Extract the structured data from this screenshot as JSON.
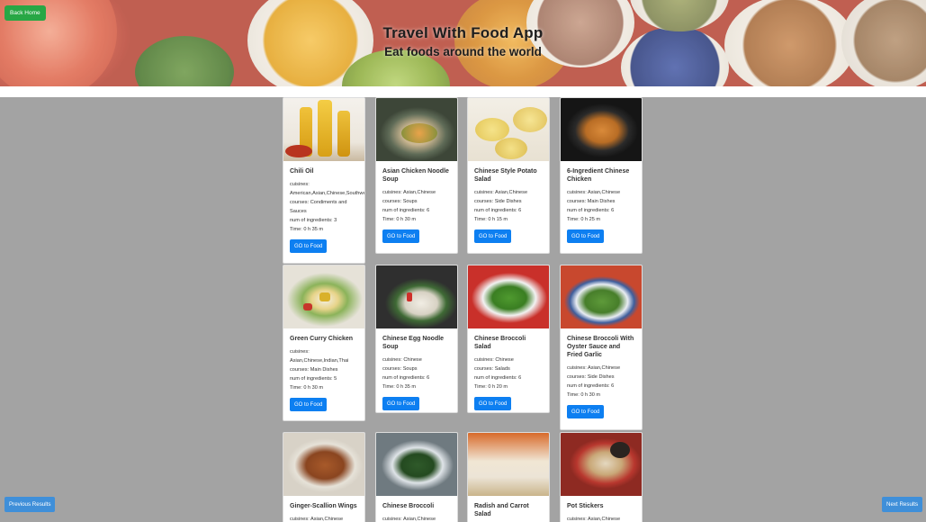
{
  "header": {
    "title": "Travel With Food App",
    "subtitle": "Eat foods around the world",
    "back_home_label": "Back Home"
  },
  "nav": {
    "previous_label": "Previous Results",
    "next_label": "Next Results"
  },
  "recipes": [
    {
      "title": "Chili Oil",
      "cuisines": "cuisines: American,Asian,Chinese,Southwestern",
      "courses": "courses: Condiments and Sauces",
      "ingredients": "num of ingredients: 3",
      "time": "Time: 0 h 35 m",
      "button": "GO to Food"
    },
    {
      "title": "Asian Chicken Noodle Soup",
      "cuisines": "cuisines: Asian,Chinese",
      "courses": "courses: Soups",
      "ingredients": "num of ingredients: 6",
      "time": "Time: 0 h 30 m",
      "button": "GO to Food"
    },
    {
      "title": "Chinese Style Potato Salad",
      "cuisines": "cuisines: Asian,Chinese",
      "courses": "courses: Side Dishes",
      "ingredients": "num of ingredients: 6",
      "time": "Time: 0 h 15 m",
      "button": "GO to Food"
    },
    {
      "title": "6-Ingredient Chinese Chicken",
      "cuisines": "cuisines: Asian,Chinese",
      "courses": "courses: Main Dishes",
      "ingredients": "num of ingredients: 6",
      "time": "Time: 0 h 25 m",
      "button": "GO to Food"
    },
    {
      "title": "Green Curry Chicken",
      "cuisines": "cuisines: Asian,Chinese,Indian,Thai",
      "courses": "courses: Main Dishes",
      "ingredients": "num of ingredients: 5",
      "time": "Time: 0 h 30 m",
      "button": "GO to Food"
    },
    {
      "title": "Chinese Egg Noodle Soup",
      "cuisines": "cuisines: Chinese",
      "courses": "courses: Soups",
      "ingredients": "num of ingredients: 6",
      "time": "Time: 0 h 35 m",
      "button": "GO to Food"
    },
    {
      "title": "Chinese Broccoli Salad",
      "cuisines": "cuisines: Chinese",
      "courses": "courses: Salads",
      "ingredients": "num of ingredients: 6",
      "time": "Time: 0 h 20 m",
      "button": "GO to Food"
    },
    {
      "title": "Chinese Broccoli With Oyster Sauce and Fried Garlic",
      "cuisines": "cuisines: Asian,Chinese",
      "courses": "courses: Side Dishes",
      "ingredients": "num of ingredients: 6",
      "time": "Time: 0 h 30 m",
      "button": "GO to Food"
    },
    {
      "title": "Ginger-Scallion Wings",
      "cuisines": "cuisines: Asian,Chinese",
      "courses": "",
      "ingredients": "",
      "time": "",
      "button": ""
    },
    {
      "title": "Chinese Broccoli",
      "cuisines": "cuisines: Asian,Chinese",
      "courses": "",
      "ingredients": "",
      "time": "",
      "button": ""
    },
    {
      "title": "Radish and Carrot Salad",
      "cuisines": "",
      "courses": "",
      "ingredients": "",
      "time": "",
      "button": ""
    },
    {
      "title": "Pot Stickers",
      "cuisines": "cuisines: Asian,Chinese",
      "courses": "",
      "ingredients": "",
      "time": "",
      "button": ""
    }
  ],
  "colors": {
    "back_home": "#28a745",
    "go_button": "#0d7ff1",
    "nav_button": "#3f8fd9",
    "background": "#a3a3a3"
  }
}
